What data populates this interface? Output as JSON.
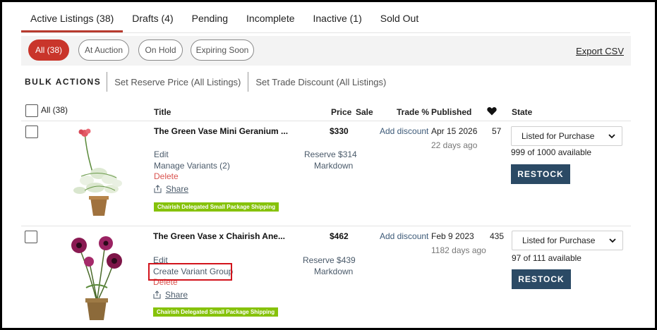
{
  "tabs": [
    {
      "label": "Active Listings (38)",
      "active": true
    },
    {
      "label": "Drafts (4)"
    },
    {
      "label": "Pending"
    },
    {
      "label": "Incomplete"
    },
    {
      "label": "Inactive (1)"
    },
    {
      "label": "Sold Out"
    }
  ],
  "filters": {
    "pills": [
      "All (38)",
      "At Auction",
      "On Hold",
      "Expiring Soon"
    ],
    "active_index": 0,
    "export_label": "Export CSV"
  },
  "bulk": {
    "title": "BULK ACTIONS",
    "actions": [
      "Set Reserve Price (All Listings)",
      "Set Trade Discount (All Listings)"
    ]
  },
  "table": {
    "select_all_label": "All (38)",
    "headers": {
      "title": "Title",
      "price": "Price",
      "sale": "Sale",
      "trade": "Trade %",
      "published": "Published",
      "favorites_icon": "heart-icon",
      "state": "State"
    },
    "rows": [
      {
        "title": "The Green Vase Mini Geranium ...",
        "actions": [
          "Edit",
          "Manage Variants (2)"
        ],
        "delete": "Delete",
        "share": "Share",
        "badge": "Chairish Delegated Small Package Shipping",
        "price": "$330",
        "reserve": "Reserve $314",
        "markdown": "Markdown",
        "trade": "Add discount",
        "published": "Apr 15 2026",
        "ago": "22 days ago",
        "likes": "57",
        "state": "Listed for Purchase",
        "available": "999 of 1000 available",
        "restock": "RESTOCK"
      },
      {
        "title": "The Green Vase x Chairish Ane...",
        "actions": [
          "Edit",
          "Create Variant Group"
        ],
        "delete": "Delete",
        "share": "Share",
        "badge": "Chairish Delegated Small Package Shipping",
        "price": "$462",
        "reserve": "Reserve $439",
        "markdown": "Markdown",
        "trade": "Add discount",
        "published": "Feb 9 2023",
        "ago": "1182 days ago",
        "likes": "435",
        "state": "Listed for Purchase",
        "available": "97 of 111 available",
        "restock": "RESTOCK"
      }
    ]
  },
  "colors": {
    "accent": "#c9352b",
    "restock": "#2b4a65",
    "badge": "#86c20a",
    "highlight": "#d2141c"
  }
}
